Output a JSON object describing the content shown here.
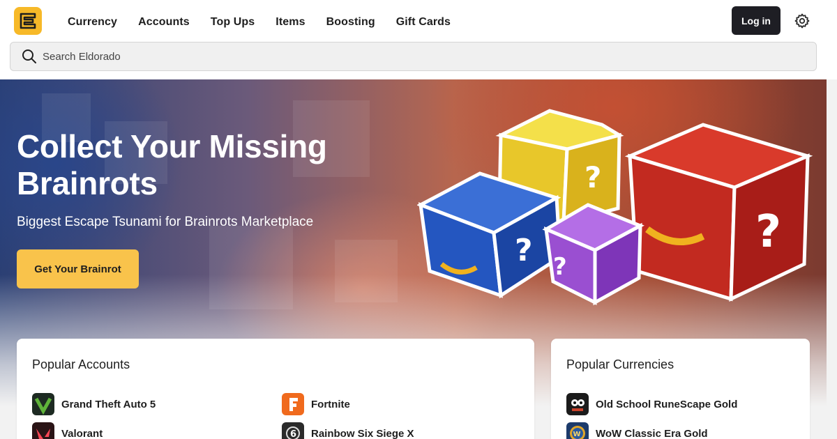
{
  "header": {
    "logo_icon": "eldorado-logo-icon",
    "nav": [
      "Currency",
      "Accounts",
      "Top Ups",
      "Items",
      "Boosting",
      "Gift Cards"
    ],
    "login_label": "Log in",
    "settings_icon": "gear-icon"
  },
  "search": {
    "placeholder": "Search Eldorado",
    "icon": "search-icon"
  },
  "hero": {
    "title": "Collect Your Missing Brainrots",
    "subtitle": "Biggest Escape Tsunami for Brainrots Marketplace",
    "cta_label": "Get Your Brainrot"
  },
  "popular_accounts": {
    "title": "Popular Accounts",
    "items": [
      {
        "name": "Grand Theft Auto 5",
        "icon": "gta5-icon"
      },
      {
        "name": "Fortnite",
        "icon": "fortnite-icon"
      },
      {
        "name": "Valorant",
        "icon": "valorant-icon"
      },
      {
        "name": "Rainbow Six Siege X",
        "icon": "rainbow-six-icon"
      }
    ]
  },
  "popular_currencies": {
    "title": "Popular Currencies",
    "items": [
      {
        "name": "Old School RuneScape Gold",
        "icon": "osrs-icon"
      },
      {
        "name": "WoW Classic Era Gold",
        "icon": "wow-icon"
      }
    ]
  },
  "colors": {
    "brand_yellow": "#f7b928",
    "cta_yellow": "#f9c34b",
    "login_dark": "#1e1e24"
  }
}
